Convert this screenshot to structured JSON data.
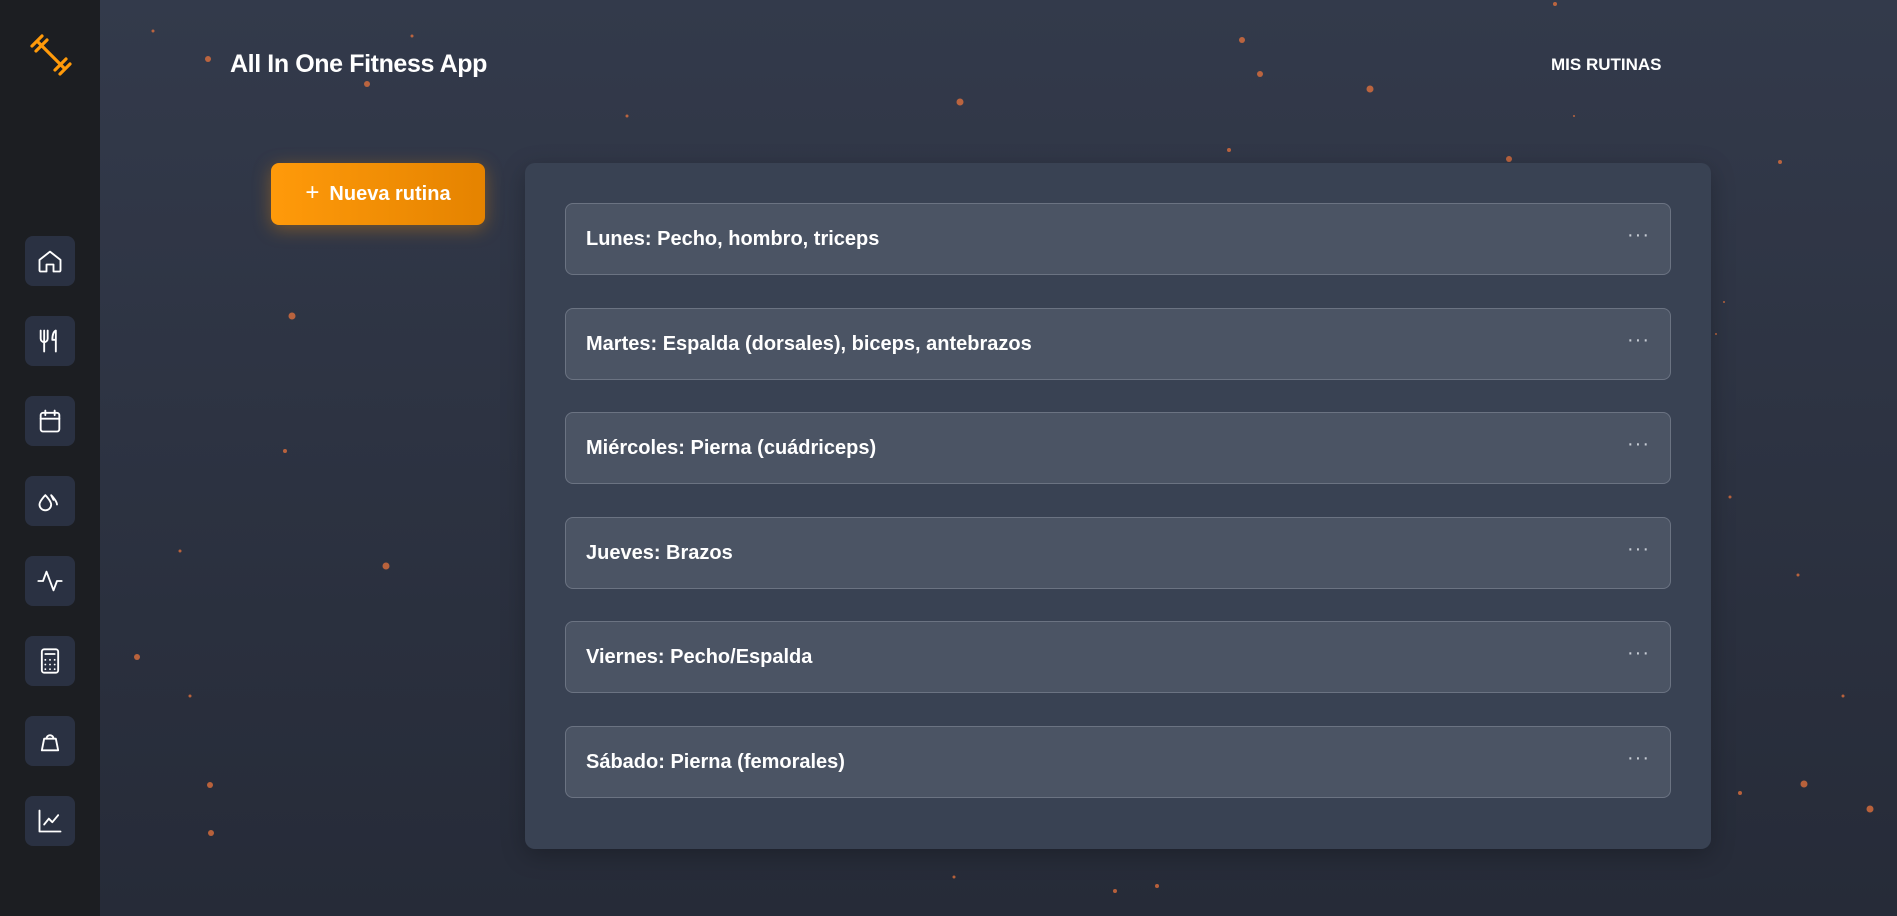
{
  "app": {
    "title": "All In One Fitness App"
  },
  "header": {
    "nav_link": "MIS RUTINAS"
  },
  "colors": {
    "accent": "#ff9a0a",
    "sidebar": "#1c1e22",
    "panel": "#394253",
    "card": "#4b5464"
  },
  "sidebar": {
    "logo_icon": "dumbbell-icon",
    "items": [
      {
        "icon": "home-icon"
      },
      {
        "icon": "utensils-icon"
      },
      {
        "icon": "calendar-icon"
      },
      {
        "icon": "droplets-icon"
      },
      {
        "icon": "activity-icon"
      },
      {
        "icon": "calculator-icon"
      },
      {
        "icon": "weight-icon"
      },
      {
        "icon": "line-chart-icon"
      }
    ]
  },
  "actions": {
    "new_routine_label": "Nueva rutina",
    "new_routine_icon": "+"
  },
  "routines": [
    {
      "name": "Lunes: Pecho, hombro, triceps",
      "menu": "···"
    },
    {
      "name": "Martes: Espalda (dorsales), biceps, antebrazos",
      "menu": "···"
    },
    {
      "name": "Miércoles: Pierna (cuádriceps)",
      "menu": "···"
    },
    {
      "name": "Jueves: Brazos",
      "menu": "···"
    },
    {
      "name": "Viernes: Pecho/Espalda",
      "menu": "···"
    },
    {
      "name": "Sábado: Pierna (femorales)",
      "menu": "···"
    }
  ]
}
